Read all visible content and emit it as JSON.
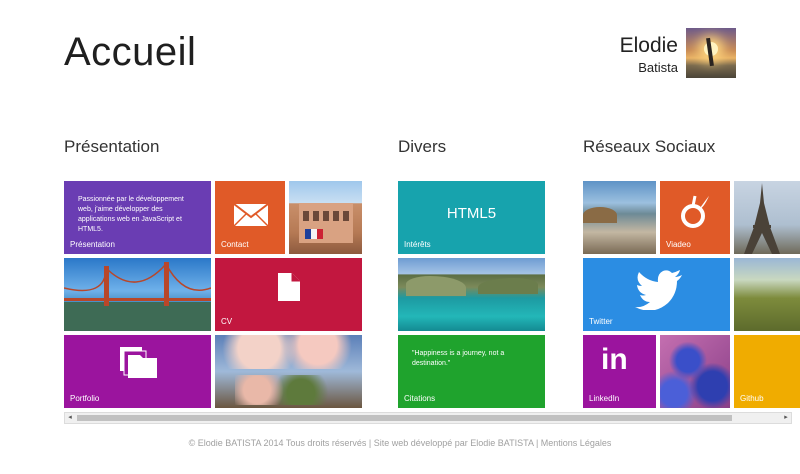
{
  "header": {
    "title": "Accueil"
  },
  "user": {
    "first_name": "Elodie",
    "last_name": "Batista"
  },
  "groups": {
    "presentation": "Présentation",
    "divers": "Divers",
    "reseaux": "Réseaux Sociaux"
  },
  "tiles": {
    "presentation_text": "Passionnée par le développement web, j'aime développer des applications web en JavaScript et HTML5.",
    "presentation_label": "Présentation",
    "contact_label": "Contact",
    "cv_label": "CV",
    "portfolio_label": "Portfolio",
    "html5_text": "HTML5",
    "interets_label": "Intérêts",
    "citation_text": "\"Happiness is a journey, not a destination.\"",
    "citations_label": "Citations",
    "twitter_label": "Twitter",
    "viadeo_label": "Viadeo",
    "linkedin_label": "LinkedIn",
    "github_label": "Github"
  },
  "colors": {
    "purple": "#6a3db3",
    "orange": "#e05a28",
    "crimson": "#c2173f",
    "magenta": "#9b149e",
    "teal": "#17a3ad",
    "green": "#1fa32d",
    "blue": "#2b8de3",
    "yellow": "#f0ac00"
  },
  "footer": {
    "text": "© Elodie BATISTA 2014 Tous droits réservés | Site web développé par Elodie BATISTA | Mentions Légales"
  }
}
